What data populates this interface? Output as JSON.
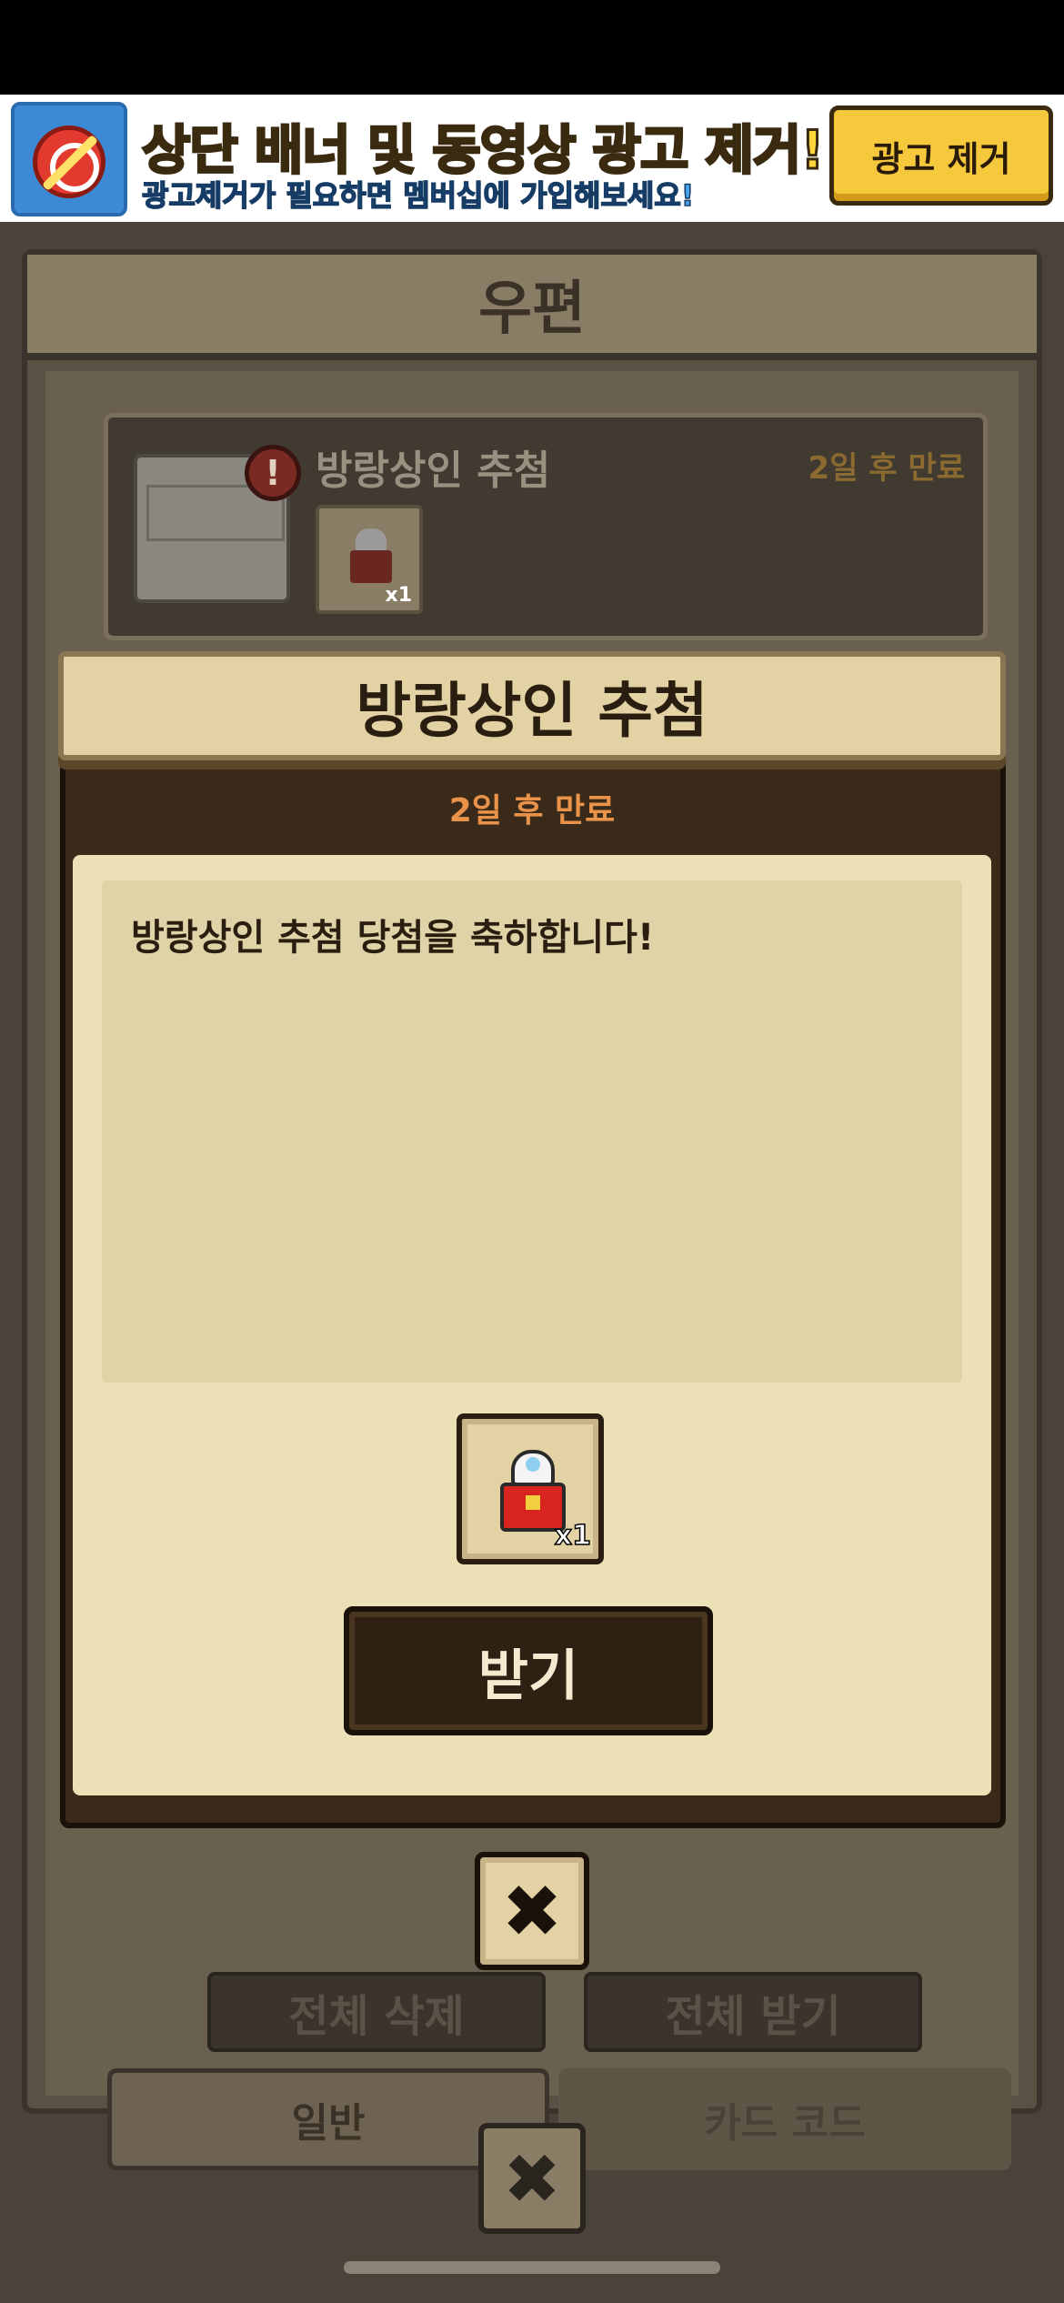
{
  "ad_banner": {
    "title": "상단 배너 및 동영상 광고 제거!",
    "subtitle": "광고제거가 필요하면 멤버십에 가입해보세요!",
    "button_label": "광고 제거",
    "icon": "no-ads-clock-icon"
  },
  "mail_window": {
    "title": "우편",
    "mail_item": {
      "title": "방랑상인 추첨",
      "expiry": "2일 후 만료",
      "alert_icon": "!",
      "reward_qty": "x1"
    },
    "buttons": {
      "delete_all": "전체 삭제",
      "receive_all": "전체 받기"
    },
    "tabs": [
      {
        "label": "일반",
        "selected": true
      },
      {
        "label": "카드 코드",
        "selected": false
      }
    ],
    "close_icon": "✖"
  },
  "popup": {
    "title": "방랑상인 추첨",
    "expiry": "2일 후 만료",
    "message": "방랑상인 추첨 당첨을 축하합니다!",
    "reward_qty": "x1",
    "claim_label": "받기",
    "close_icon": "✖"
  },
  "colors": {
    "popup_bg": "#ece0b6",
    "expiry": "#e8924a",
    "ad_title": "#ffd53a",
    "ad_sub": "#4aa3e8"
  }
}
